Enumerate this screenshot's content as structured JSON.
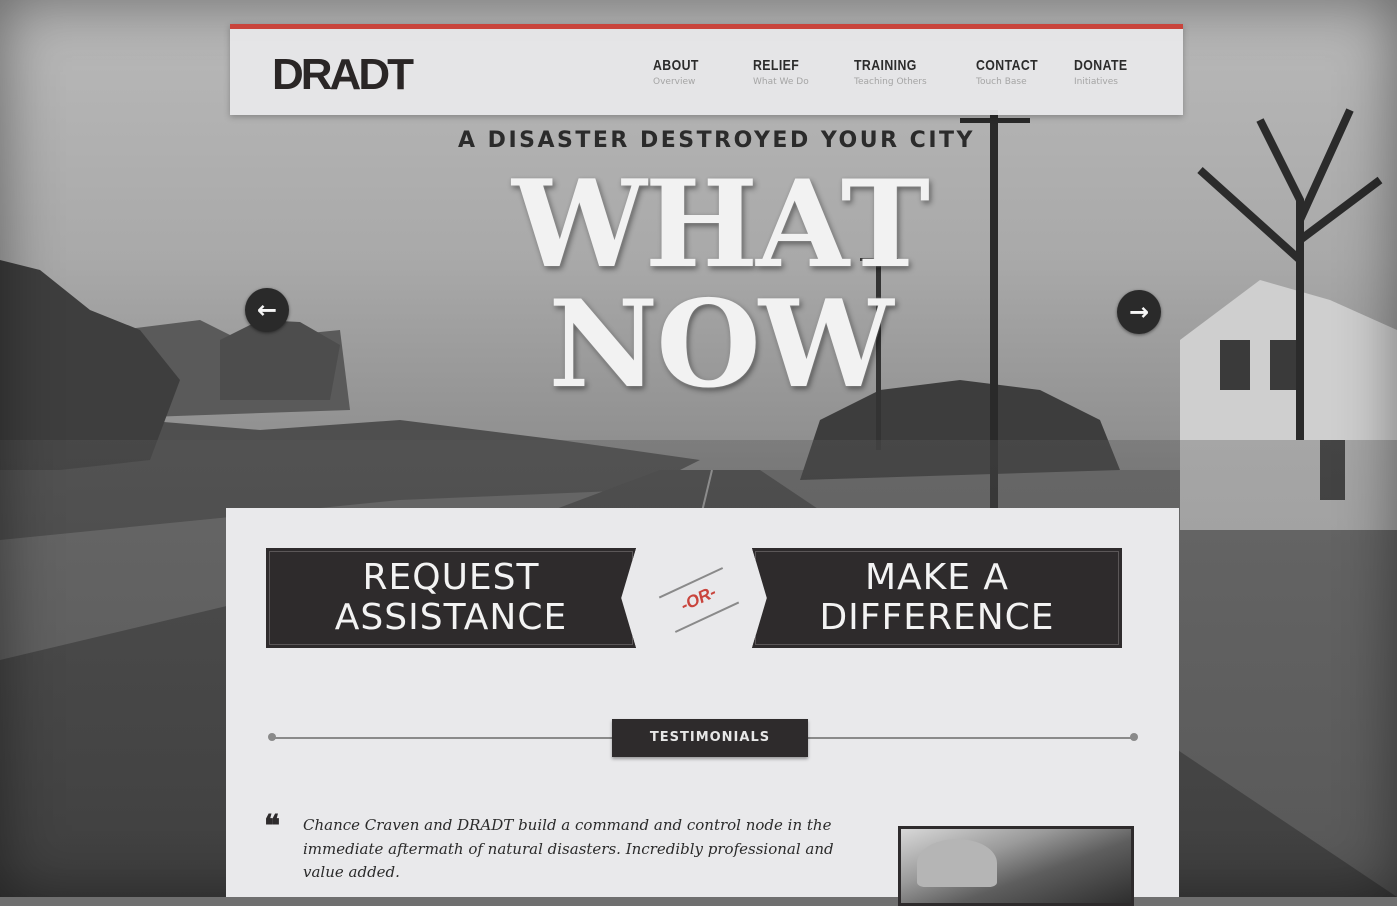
{
  "header": {
    "logo": "DRADT",
    "accent_color": "#c9443c",
    "nav": [
      {
        "title": "ABOUT",
        "subtitle": "Overview"
      },
      {
        "title": "RELIEF",
        "subtitle": "What We Do"
      },
      {
        "title": "TRAINING",
        "subtitle": "Teaching Others"
      },
      {
        "title": "CONTACT",
        "subtitle": "Touch Base"
      },
      {
        "title": "DONATE",
        "subtitle": "Initiatives"
      }
    ]
  },
  "hero": {
    "tagline": "A DISASTER DESTROYED YOUR CITY",
    "headline_line1": "WHAT",
    "headline_line2": "NOW",
    "prev_icon": "arrow-left-icon",
    "next_icon": "arrow-right-icon"
  },
  "actions": {
    "request_line1": "REQUEST",
    "request_line2": "ASSISTANCE",
    "or_label": "-OR-",
    "difference_line1": "MAKE A",
    "difference_line2": "DIFFERENCE"
  },
  "testimonials": {
    "label": "TESTIMONIALS",
    "quote": "Chance Craven and DRADT build a command and control node in the immediate aftermath of natural disasters. Incredibly professional and value added."
  }
}
